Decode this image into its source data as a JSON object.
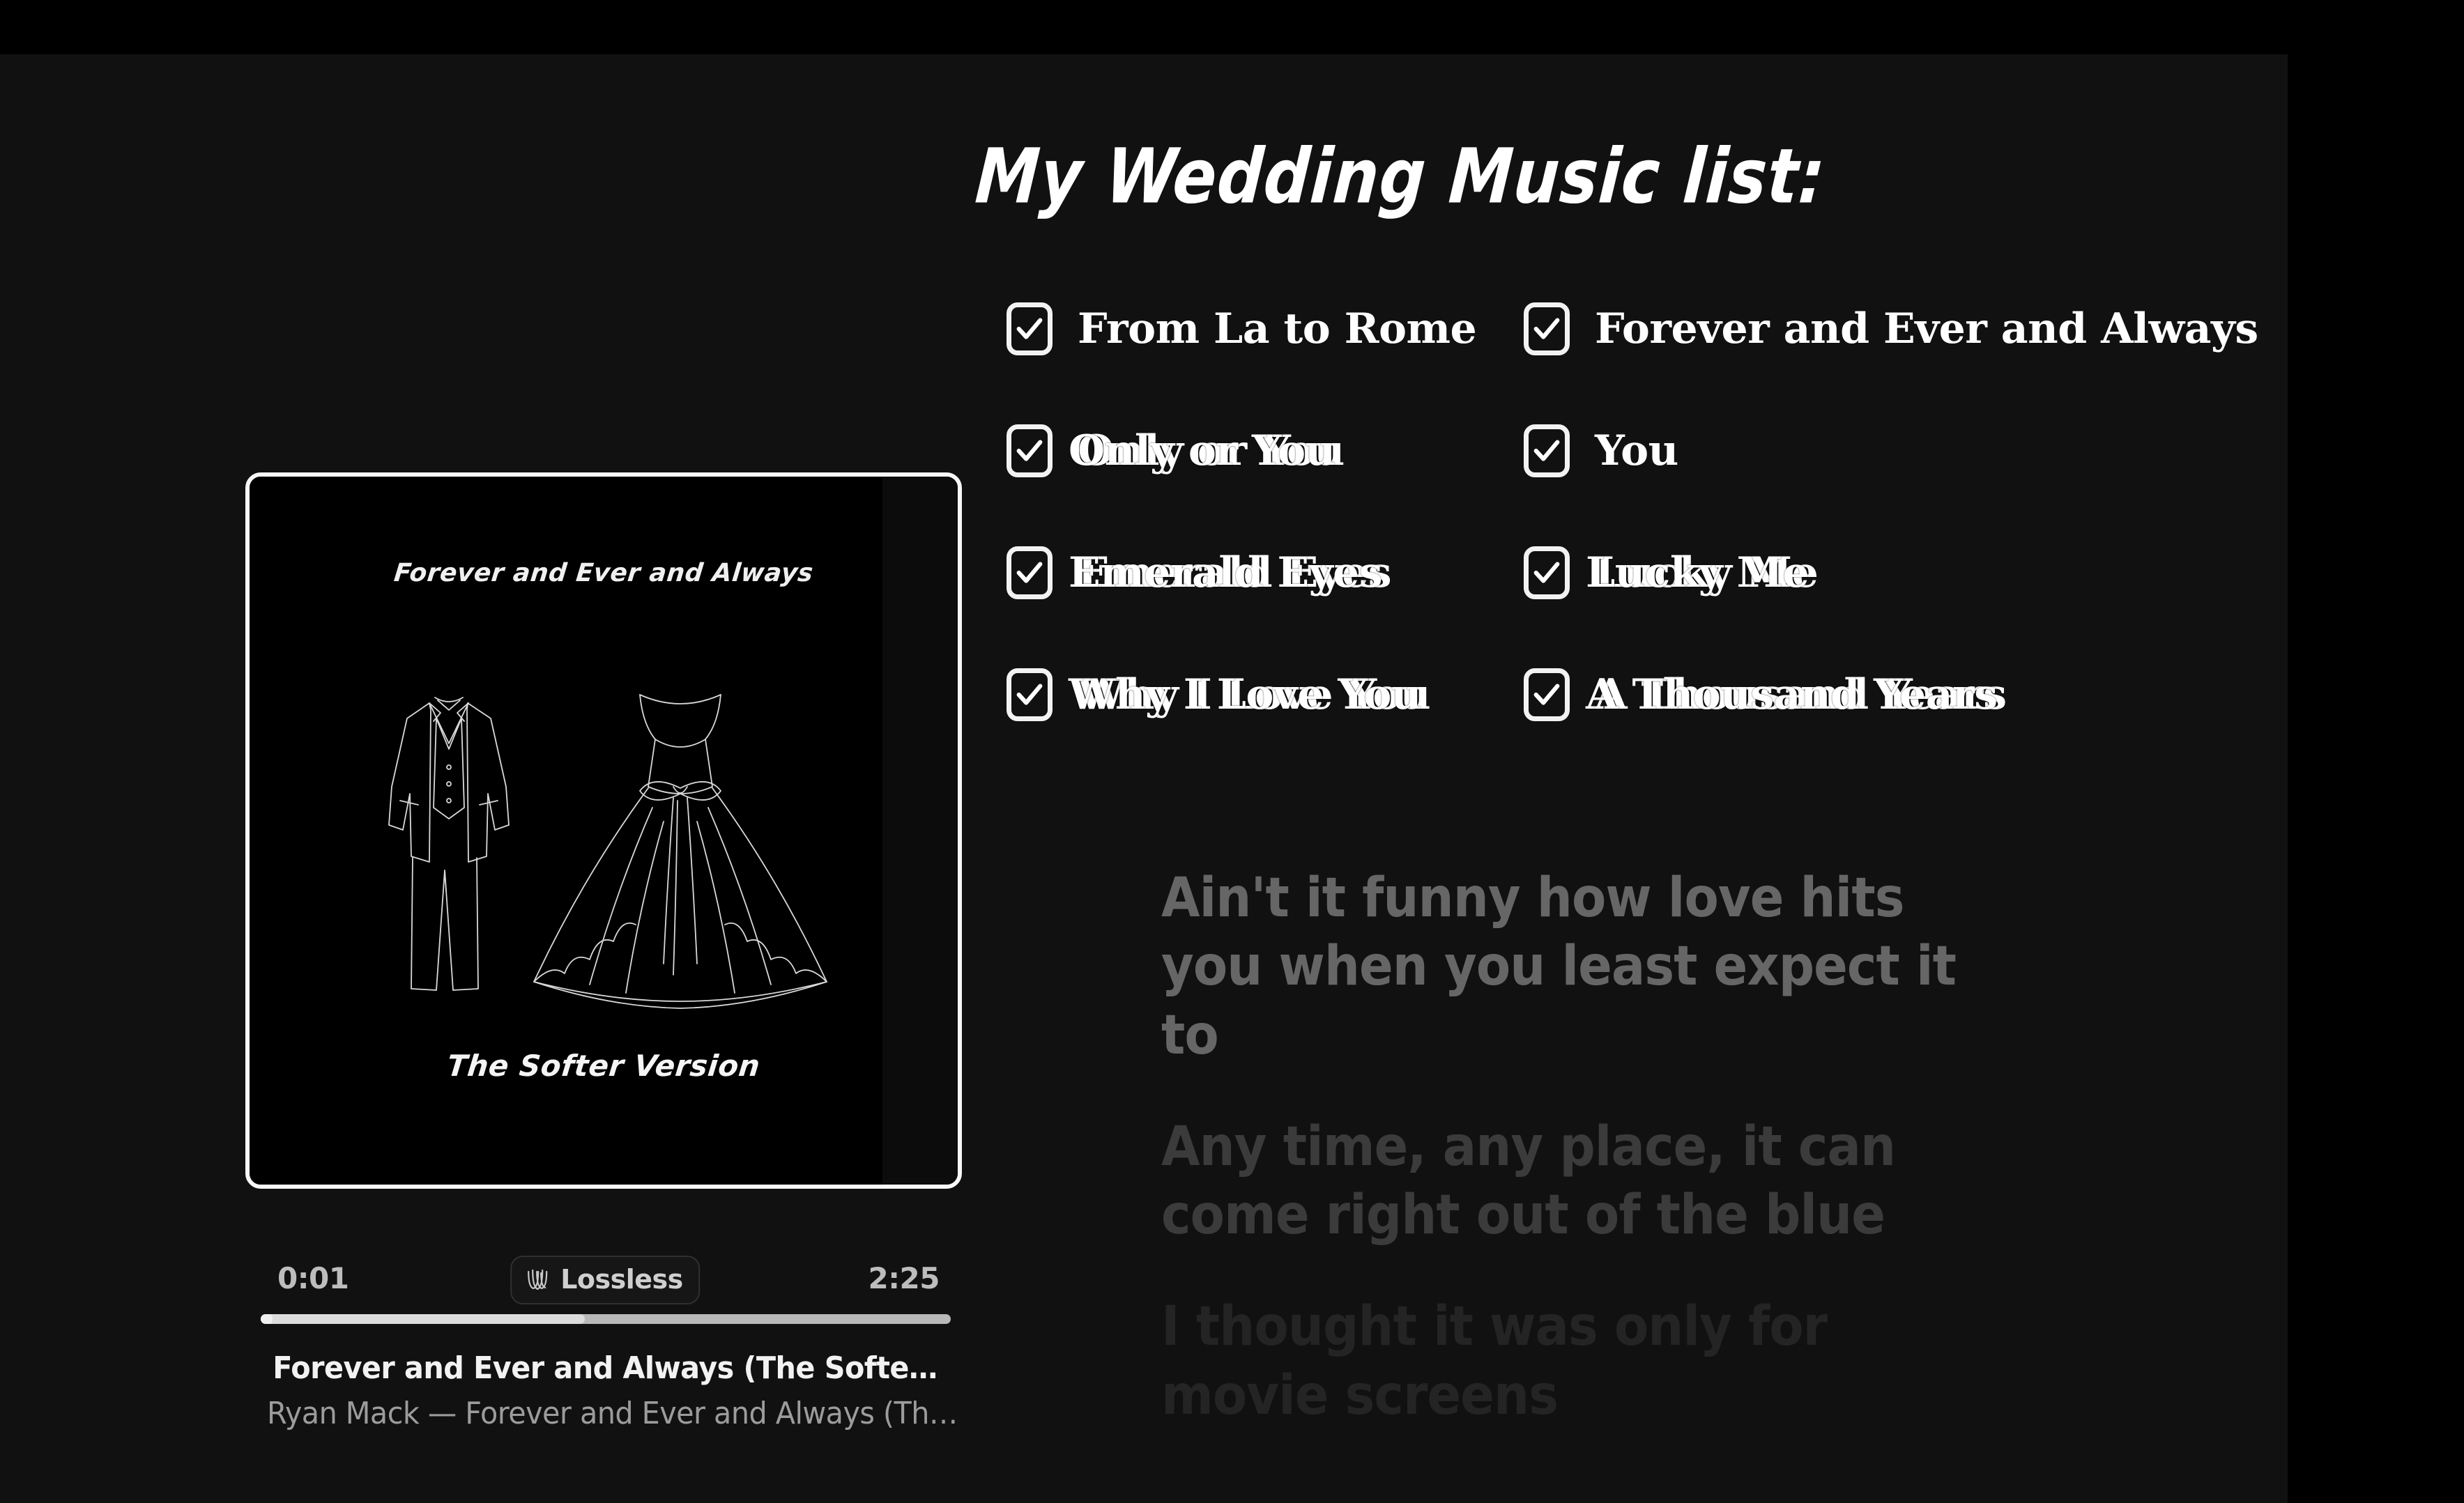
{
  "colors": {
    "background": "#000000",
    "panel": "#111111",
    "text_primary": "#ffffff",
    "lyric_active": "#666666",
    "lyric_dim": "#3b3b3b",
    "lyric_dimmest": "#242424",
    "checkbox_border": "#f2f2f2",
    "progress_track": "#b9b9b9",
    "progress_fill": "#dcdcdc"
  },
  "checklist": {
    "title": "My Wedding Music list:",
    "rows": [
      {
        "left": {
          "label": "From La to Rome",
          "checked": true,
          "ghost": ""
        },
        "right": {
          "label": "Forever and Ever and Always",
          "checked": true,
          "ghost": ""
        }
      },
      {
        "left": {
          "label": "Only or You",
          "checked": true,
          "ghost": "Only or You"
        },
        "right": {
          "label": "You",
          "checked": true,
          "ghost": ""
        }
      },
      {
        "left": {
          "label": "Emerald Eyes",
          "checked": true,
          "ghost": "Emerald Eyes"
        },
        "right": {
          "label": "Lucky Me",
          "checked": true,
          "ghost": "Lucky Me"
        }
      },
      {
        "left": {
          "label": "Why I Love You",
          "checked": true,
          "ghost": "Why I Love You"
        },
        "right": {
          "label": "A Thousand Years",
          "checked": true,
          "ghost": "A Thousand Years"
        }
      }
    ]
  },
  "lyrics": {
    "lines": [
      "Ain't it funny how love hits you when you least expect it to",
      "Any time, any place, it can come right out of the blue",
      "I thought it was only for movie screens"
    ]
  },
  "player": {
    "artwork": {
      "title": "Forever and Ever and Always",
      "subtitle": "The Softer Version",
      "illustration": "suit-and-wedding-dress-line-drawing"
    },
    "elapsed_time": "0:01",
    "total_time": "2:25",
    "quality_badge": {
      "label": "Lossless",
      "icon": "lossless-waveform-icon"
    },
    "progress_percent": 47,
    "track_title": "Forever and Ever and Always (The Softe…",
    "track_artist": "Ryan Mack — Forever and Ever and Always (Th…"
  },
  "icons": {
    "checkmark": "check-icon"
  }
}
